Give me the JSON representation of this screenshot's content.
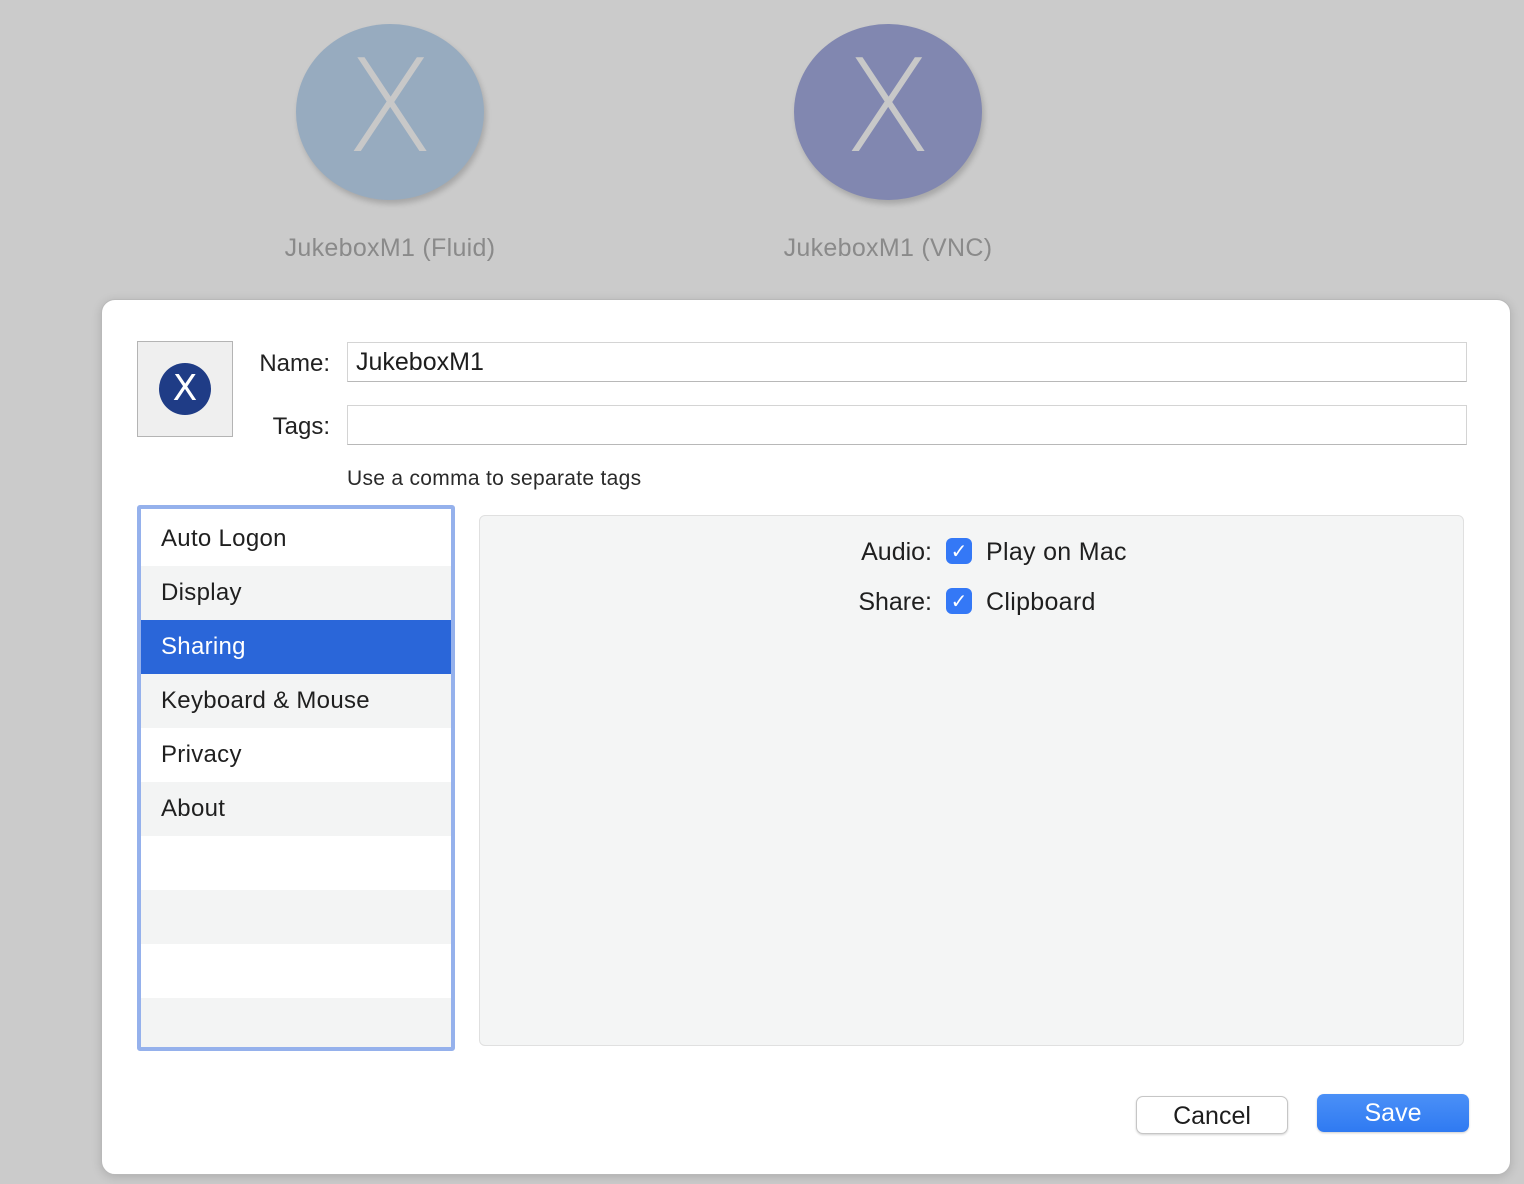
{
  "connections": [
    {
      "glyph": "X",
      "label": "JukeboxM1 (Fluid)",
      "color": "#97abbf"
    },
    {
      "glyph": "X",
      "label": "JukeboxM1 (VNC)",
      "color": "#8187b0"
    }
  ],
  "editor": {
    "icon_glyph": "X",
    "name_label": "Name:",
    "name_value": "JukeboxM1",
    "tags_label": "Tags:",
    "tags_value": "",
    "tags_hint": "Use a comma to separate tags",
    "categories": [
      "Auto Logon",
      "Display",
      "Sharing",
      "Keyboard & Mouse",
      "Privacy",
      "About",
      "",
      "",
      "",
      ""
    ],
    "selected_category": "Sharing",
    "sharing": {
      "audio_label": "Audio:",
      "audio_option": "Play on Mac",
      "audio_checked": true,
      "share_label": "Share:",
      "share_option": "Clipboard",
      "share_checked": true,
      "check_glyph": "✓"
    },
    "cancel_label": "Cancel",
    "save_label": "Save"
  },
  "colors": {
    "accent": "#2a66d9",
    "checkbox": "#3478f6",
    "save_button": "#3d86f6",
    "list_focus_ring": "#95b1ec"
  }
}
